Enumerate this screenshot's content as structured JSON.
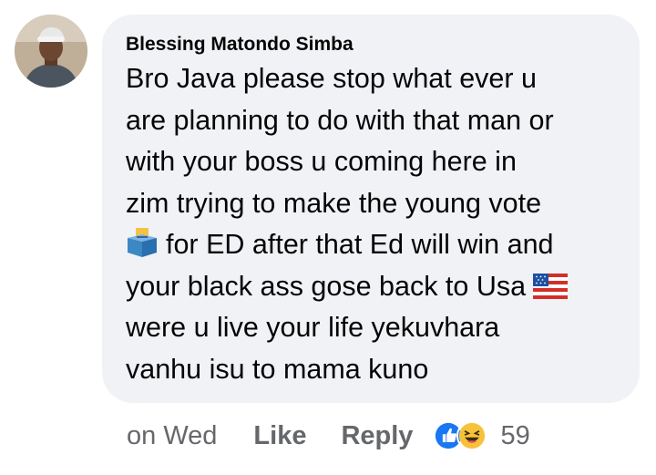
{
  "comment": {
    "author": "Blessing Matondo Simba",
    "avatar": "profile-photo",
    "text_lines": [
      "Bro Java please stop what ever u",
      "are planning to do with that man or",
      "with your boss  u coming here in",
      "zim trying to make the young vote",
      "for ED after that Ed will win and",
      "your black ass gose back to Usa",
      "were u live your life yekuvhara",
      "vanhu isu to mama kuno"
    ],
    "emojis": {
      "ballot": "ballot-box-emoji",
      "flag": "us-flag-emoji"
    },
    "bubble_color": "#f0f2f5"
  },
  "actions": {
    "timestamp": "on Wed",
    "like_label": "Like",
    "reply_label": "Reply",
    "reaction_icons": [
      "like-reaction-icon",
      "laugh-reaction-icon"
    ],
    "reaction_count": "59",
    "meta_color": "#65676b",
    "like_color": "#1877f2"
  }
}
